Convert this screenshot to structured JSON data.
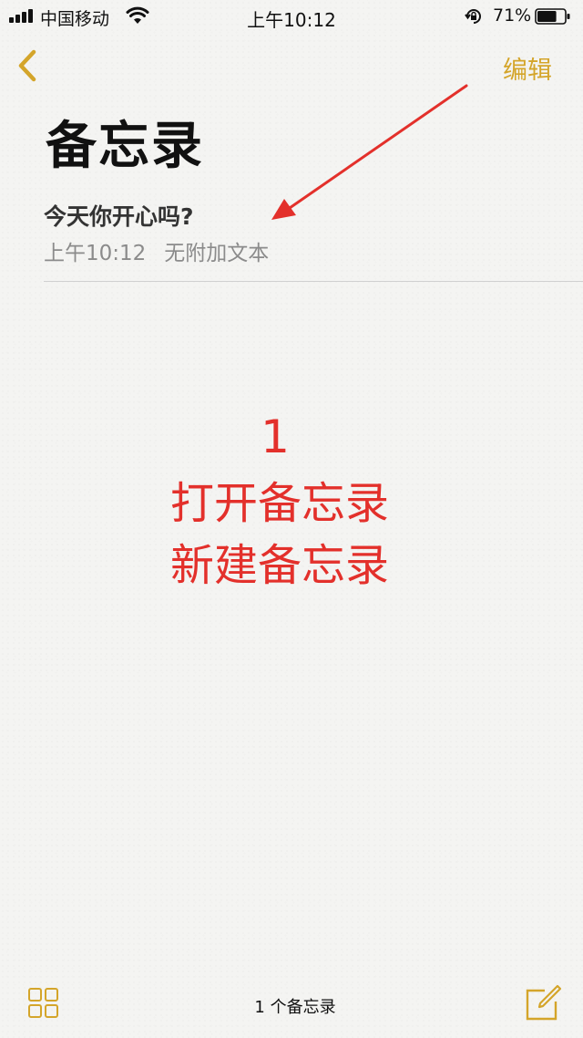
{
  "status_bar": {
    "carrier": "中国移动",
    "time": "上午10:12",
    "battery_percent": "71%",
    "battery_level": 0.71,
    "icons": [
      "signal-icon",
      "wifi-icon",
      "rotation-lock-icon",
      "battery-icon"
    ]
  },
  "nav": {
    "back_icon": "chevron-left-icon",
    "edit_label": "编辑"
  },
  "page": {
    "title": "备忘录"
  },
  "notes": [
    {
      "title": "今天你开心吗?",
      "time": "上午10:12",
      "subtitle": "无附加文本"
    }
  ],
  "annotation": {
    "number": "1",
    "line1": "打开备忘录",
    "line2": "新建备忘录",
    "color": "#e3302b"
  },
  "toolbar": {
    "count_label": "1 个备忘录",
    "left_icon": "grid-icon",
    "right_icon": "compose-icon"
  },
  "colors": {
    "accent": "#d4a52a",
    "annotation": "#e3302b",
    "background": "#f4f4f2"
  }
}
